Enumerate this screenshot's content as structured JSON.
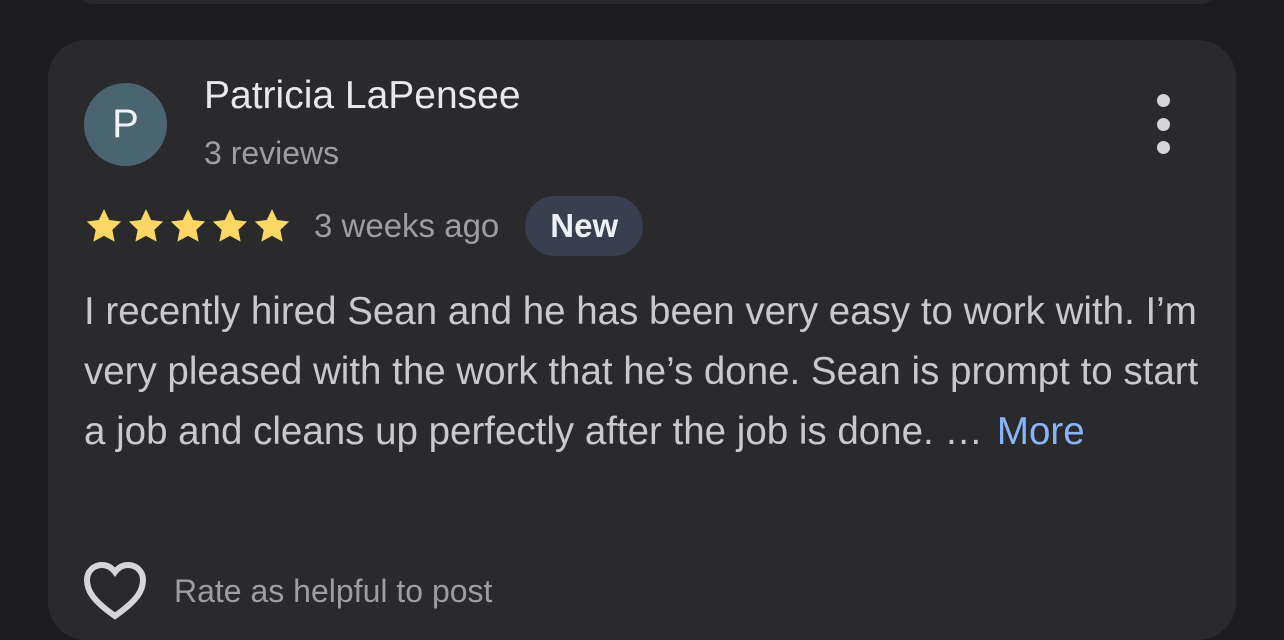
{
  "review": {
    "avatar_letter": "P",
    "name": "Patricia LaPensee",
    "review_count": "3 reviews",
    "stars": 5,
    "age": "3 weeks ago",
    "badge": "New",
    "text": "I recently hired Sean and he has been very easy to work with. I’m very pleased with the work that he’s done. Sean is prompt to start a job and cleans up perfectly after the job is done. …",
    "more_label": "More",
    "helpful_label": "Rate as helpful to post"
  },
  "colors": {
    "background": "#1c1c1e",
    "card": "#2a2a2d",
    "avatar": "#4a6470",
    "star": "#fdd663",
    "badge": "#3a3f50",
    "link": "#8ab4f8"
  },
  "icons": [
    "star-icon",
    "more-vert-icon",
    "heart-outline-icon"
  ]
}
